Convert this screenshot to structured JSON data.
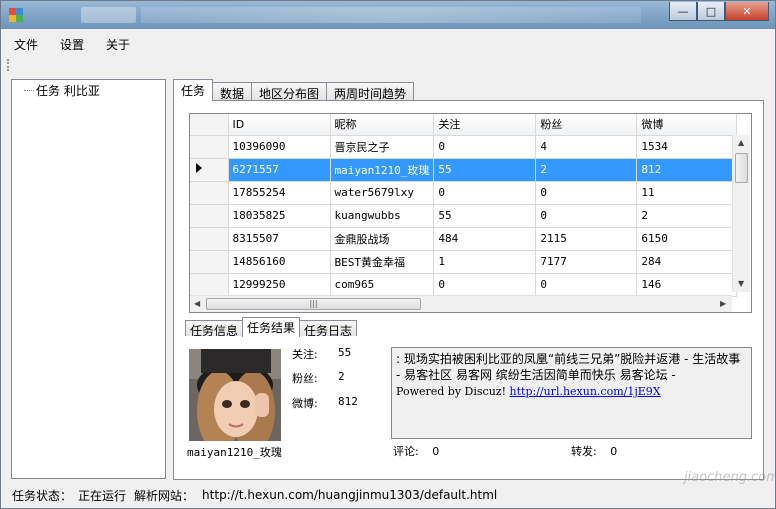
{
  "window": {
    "close_glyph": "✕",
    "minimize_glyph": "—",
    "maximize_glyph": "□"
  },
  "menu": {
    "items": [
      "文件",
      "设置",
      "关于"
    ]
  },
  "tree": {
    "node_label": "任务  利比亚"
  },
  "main_tabs": [
    "任务",
    "数据",
    "地区分布图",
    "两周时间趋势"
  ],
  "grid": {
    "columns": [
      "ID",
      "昵称",
      "关注",
      "粉丝",
      "微博"
    ],
    "rows": [
      [
        "10396090",
        "晋京民之子",
        "0",
        "4",
        "1534"
      ],
      [
        "6271557",
        "maiyan1210_玫瑰",
        "55",
        "2",
        "812"
      ],
      [
        "17855254",
        "water5679lxy",
        "0",
        "0",
        "11"
      ],
      [
        "18035825",
        "kuangwubbs",
        "55",
        "0",
        "2"
      ],
      [
        "8315507",
        "金鼎股战场",
        "484",
        "2115",
        "6150"
      ],
      [
        "14856160",
        "BEST黄金幸福",
        "1",
        "7177",
        "284"
      ],
      [
        "12999250",
        "com965",
        "0",
        "0",
        "146"
      ]
    ],
    "selected_row": 1,
    "hscroll_grip": "|||"
  },
  "sub_tabs": [
    "任务信息",
    "任务结果",
    "任务日志"
  ],
  "result": {
    "username": "maiyan1210_玫瑰",
    "follow_label": "关注:",
    "follow_value": "55",
    "fans_label": "粉丝:",
    "fans_value": "2",
    "weibo_label": "微博:",
    "weibo_value": "812",
    "post_text": ": 现场实拍被困利比亚的凤凰“前线三兄弟”脱险并返港 - 生活故事 - 易客社区 易客网 缤纷生活因简单而快乐 易客论坛 -",
    "post_powered": "Powered by Discuz! ",
    "post_link": "http://url.hexun.com/1jE9X",
    "comment_label": "评论:",
    "comment_value": "0",
    "repost_label": "转发:",
    "repost_value": "0"
  },
  "status": {
    "state_label": "任务状态：",
    "state_value": "正在运行",
    "site_label": "解析网站：",
    "site_value": "http://t.hexun.com/huangjinmu1303/default.html"
  },
  "watermark": "jiaocheng.com",
  "colors": {
    "selection": "#3399ff",
    "link": "#0000ee",
    "titlebar": "#7fa3c6"
  }
}
